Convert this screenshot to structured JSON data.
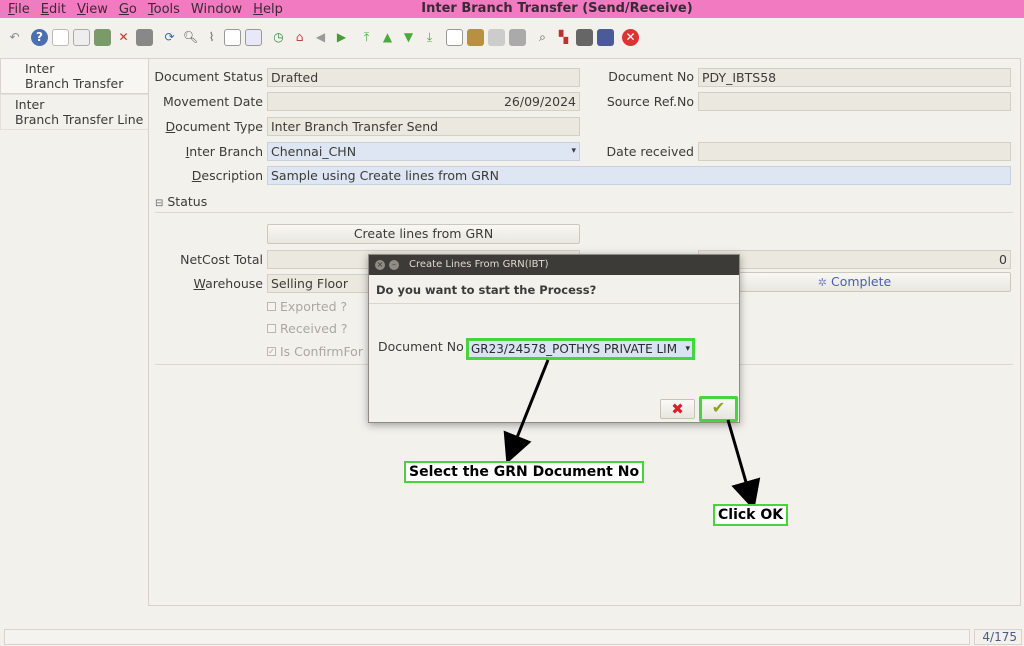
{
  "window": {
    "title": "Inter Branch Transfer (Send/Receive)"
  },
  "menu": [
    {
      "key": "F",
      "rest": "ile"
    },
    {
      "key": "E",
      "rest": "dit"
    },
    {
      "key": "V",
      "rest": "iew"
    },
    {
      "key": "G",
      "rest": "o"
    },
    {
      "key": "T",
      "rest": "ools"
    },
    {
      "key": "",
      "rest": "Window"
    },
    {
      "key": "H",
      "rest": "elp"
    }
  ],
  "tabs": {
    "header": [
      "Inter",
      "Branch Transfer"
    ],
    "line": [
      "Inter",
      "Branch Transfer Line"
    ]
  },
  "form": {
    "document_status_label": "Document Status",
    "document_status": "Drafted",
    "document_no_label": "Document No",
    "document_no": "PDY_IBTS58",
    "movement_date_label": "Movement Date",
    "movement_date": "26/09/2024",
    "source_ref_label": "Source Ref.No",
    "source_ref": "",
    "document_type_label_key": "D",
    "document_type_label_rest": "ocument Type",
    "document_type": "Inter Branch Transfer Send",
    "inter_branch_label_key": "I",
    "inter_branch_label_rest": "nter Branch",
    "inter_branch": "Chennai_CHN",
    "date_received_label": "Date received",
    "date_received": "",
    "description_label_key": "D",
    "description_label_rest": "escription",
    "description": "Sample using Create lines from GRN",
    "status_section": "Status",
    "create_lines_button": "Create lines from GRN",
    "netcost_label": "NetCost Total",
    "netcost_right_value": "0",
    "warehouse_label_key": "W",
    "warehouse_label_rest": "arehouse",
    "warehouse": "Selling Floor",
    "complete_button": "Complete",
    "exported_label": "Exported ?",
    "received_label": "Received ?",
    "confirm_label": "Is ConfirmFor"
  },
  "dialog": {
    "title": "Create Lines From GRN(IBT)",
    "question": "Do you want to start the Process?",
    "document_no_label": "Document No",
    "document_no_value": "GR23/24578_POTHYS PRIVATE LIM"
  },
  "annotations": {
    "select_grn": "Select the GRN Document No",
    "click_ok": "Click OK"
  },
  "statusbar": {
    "record_count": "4/175"
  },
  "colors": {
    "menubar": "#f27ac0",
    "highlight": "#47d43c"
  }
}
